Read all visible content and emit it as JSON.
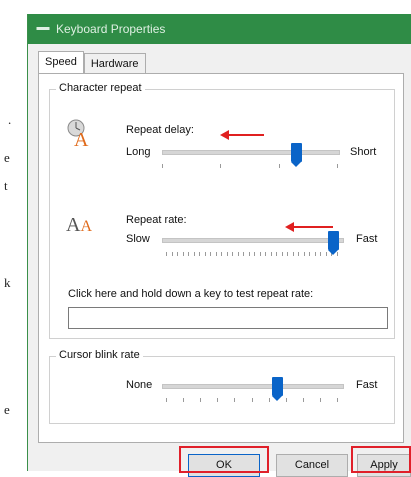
{
  "background_fragments": [
    ".",
    "e",
    "t",
    "k",
    "e"
  ],
  "window": {
    "title": "Keyboard Properties"
  },
  "tabs": [
    {
      "label": "Speed"
    },
    {
      "label": "Hardware"
    }
  ],
  "character_repeat": {
    "group_label": "Character repeat",
    "repeat_delay": {
      "label": "Repeat delay:",
      "min_label": "Long",
      "max_label": "Short",
      "value_fraction": 0.78
    },
    "repeat_rate": {
      "label": "Repeat rate:",
      "min_label": "Slow",
      "max_label": "Fast",
      "value_fraction": 0.98
    },
    "test_label": "Click here and hold down a key to test repeat rate:",
    "test_value": ""
  },
  "cursor_blink": {
    "group_label": "Cursor blink rate",
    "min_label": "None",
    "max_label": "Fast",
    "value_fraction": 0.65
  },
  "buttons": {
    "ok": "OK",
    "cancel": "Cancel",
    "apply": "Apply"
  },
  "colors": {
    "titlebar": "#2f8c46",
    "slider_thumb": "#0a64c8",
    "highlight": "#e0202a"
  },
  "icons": {
    "repeat_delay": "delay-clock-a-icon",
    "repeat_rate": "double-a-icon"
  }
}
